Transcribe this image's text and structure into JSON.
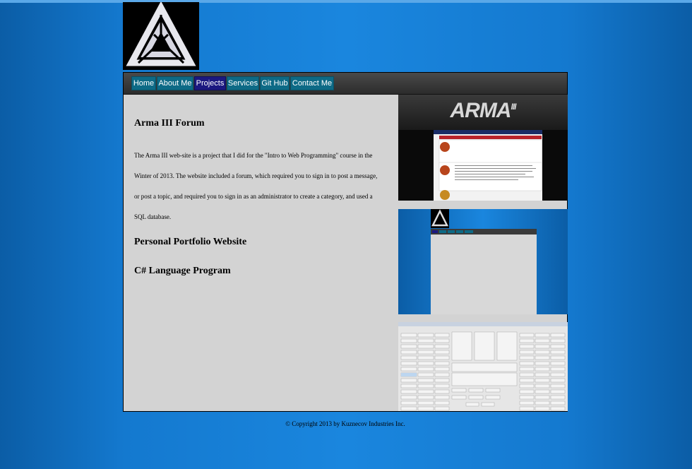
{
  "nav": {
    "items": [
      {
        "label": "Home",
        "active": false
      },
      {
        "label": "About Me",
        "active": false
      },
      {
        "label": "Projects",
        "active": true
      },
      {
        "label": "Services",
        "active": false
      },
      {
        "label": "Git Hub",
        "active": false
      },
      {
        "label": "Contact Me",
        "active": false
      }
    ]
  },
  "content": {
    "project1_title": "Arma III Forum",
    "project1_desc": "The Arma III web-site is a project that I did for the \"Intro to Web Programming\" course in the Winter of 2013. The website included a forum, which required you to sign in to post a message, or post a topic, and required you to sign in as an administrator to create a category, and used a SQL database.",
    "project2_title": "Personal Portfolio Website",
    "project3_title": "C# Language Program"
  },
  "screenshots": {
    "arma_logo_text": "ARMA",
    "arma_logo_sub": "III"
  },
  "footer": {
    "copyright": "© Copyright 2013 by Kuznecov Industries Inc."
  },
  "colors": {
    "nav_item": "#0d6a86",
    "nav_active": "#1b1880",
    "content_bg": "#d3d3d3",
    "page_bg": "#1a86de"
  }
}
